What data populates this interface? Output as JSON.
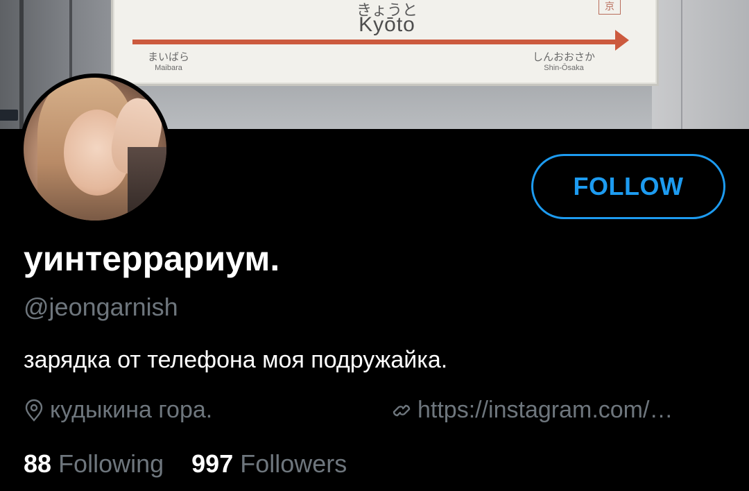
{
  "banner": {
    "sign_kana_main": "きょうと",
    "sign_romaji_main": "Kyōto",
    "sign_kanji_box": "京",
    "left_station_kana": "まいばら",
    "left_station_romaji": "Maibara",
    "right_station_kana": "しんおおさか",
    "right_station_romaji": "Shin-Ōsaka"
  },
  "profile": {
    "display_name": "уинтеррариум.",
    "handle": "@jeongarnish",
    "bio": "зарядка от телефона моя подружайка.",
    "location": "кудыкина гора.",
    "website": "https://instagram.com/…",
    "following_count": "88",
    "following_label": "Following",
    "followers_count": "997",
    "followers_label": "Followers"
  },
  "actions": {
    "follow_label": "FOLLOW"
  },
  "icons": {
    "location": "location-pin-icon",
    "link": "link-icon"
  },
  "colors": {
    "accent": "#1d9bf0",
    "background": "#000000",
    "secondary_text": "#6e767d",
    "primary_text": "#ffffff"
  }
}
